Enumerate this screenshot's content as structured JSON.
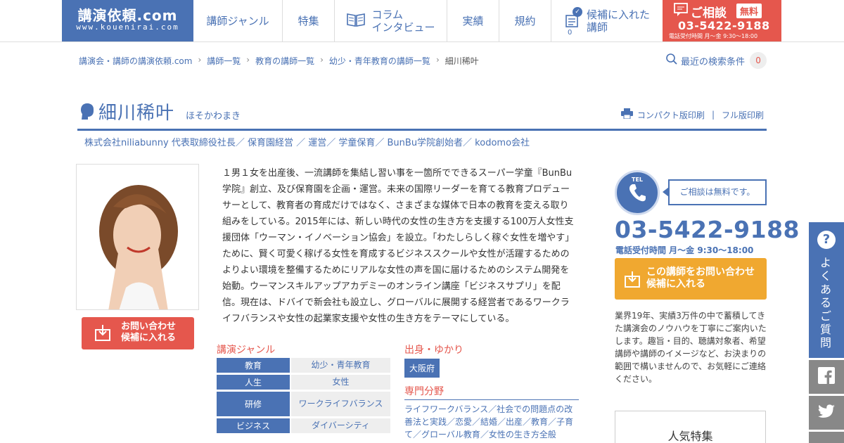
{
  "header": {
    "logo_main": "講演依頼.com",
    "logo_sub": "www.kouenirai.com",
    "nav": {
      "genre": "講師ジャンル",
      "special": "特集",
      "column_line1": "コラム",
      "column_line2": "インタビュー",
      "results": "実績",
      "rules": "規約",
      "candidates_line1": "候補に入れた",
      "candidates_line2": "講師",
      "candidates_count": "0"
    },
    "consult": {
      "title": "ご相談",
      "free": "無料",
      "phone": "03-5422-9188",
      "hours": "電話受付時間 月〜金 9:30〜18:00"
    }
  },
  "breadcrumb": {
    "items": [
      "講演会・講師の講演依頼.com",
      "講師一覧",
      "教育の講師一覧",
      "幼少・青年教育の講師一覧"
    ],
    "current": "細川稀叶"
  },
  "recent_search": {
    "label": "最近の検索条件",
    "count": "0"
  },
  "speaker": {
    "name": "細川稀叶",
    "kana": "ほそかわまき",
    "titles": "株式会社niliabunny 代表取締役社長／ 保育園経営 ／ 運営／ 学童保育／ BunBu学院創始者／ kodomo会社",
    "bio": "１男１女を出産後、一流講師を集結し習い事を一箇所でできるスーパー学童『BunBu学院』創立、及び保育園を企画・運営。未来の国際リーダーを育てる教育プロデューサーとして、教育者の育成だけではなく、さまざまな媒体で日本の教育を変える取り組みをしている。2015年には、新しい時代の女性の生き方を支援する100万人女性支援団体「ウーマン・イノベーション協会」を設立。「わたしらしく稼ぐ女性を増やす」ために、賢く可愛く稼げる女性を育成するビジネススクールや女性が活躍するためのよりよい環境を整備するためにリアルな女性の声を国に届けるためのシステム開発を始動。ウーマンスキルアップアカデミーのオンライン講座「ビジネスサプリ」を配信。現在は、ドバイで新会社も設立し、グローバルに展開する経営者であるワークライフバランスや女性の起業家支援や女性の生き方をテーマにしている。"
  },
  "print": {
    "compact": "コンパクト版印刷",
    "full": "フル版印刷"
  },
  "inquiry_button": {
    "line1": "お問い合わせ",
    "line2": "候補に入れる"
  },
  "genre": {
    "label": "講演ジャンル",
    "rows": [
      {
        "k": "教育",
        "v": "幼少・青年教育"
      },
      {
        "k": "人生",
        "v": "女性"
      },
      {
        "k": "研修",
        "v": "ワークライフバランス"
      },
      {
        "k": "ビジネス",
        "v": "ダイバーシティ"
      }
    ]
  },
  "origin": {
    "label": "出身・ゆかり",
    "value": "大阪府"
  },
  "field": {
    "label": "専門分野",
    "text": "ライフワークバランス／社会での問題点の改善法と実践／恋愛／結婚／出産／教育／子育て／グローバル教育／女性の生き方全般"
  },
  "right": {
    "tel_label": "TEL",
    "bubble": "ご相談は無料です。",
    "phone": "03-5422-9188",
    "hours": "電話受付時間 月〜金 9:30〜18:00",
    "btn_line1": "この講師をお問い合わせ",
    "btn_line2": "候補に入れる",
    "desc": "業界19年、実績3万件の中で蓄積してきた講演会のノウハウを丁寧にご案内いたします。趣旨・目的、聴講対象者、希望講師や講師のイメージなど、お決まりの範囲で構いませんので、お気軽にご連絡ください。",
    "popular": "人気特集"
  },
  "side": {
    "faq": "よくあるご質問"
  },
  "colors": {
    "brand_blue": "#4a72b4",
    "accent_red": "#e5574d",
    "accent_orange": "#f0a830"
  }
}
